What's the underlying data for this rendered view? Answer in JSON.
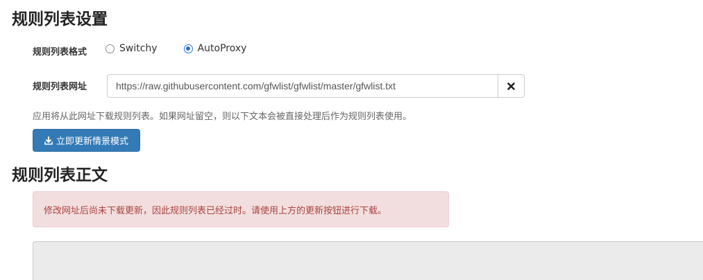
{
  "rule_list_settings": {
    "title": "规则列表设置",
    "format_label": "规则列表格式",
    "format_options": [
      {
        "label": "Switchy",
        "checked": false
      },
      {
        "label": "AutoProxy",
        "checked": true
      }
    ],
    "url_label": "规则列表网址",
    "url_value": "https://raw.githubusercontent.com/gfwlist/gfwlist/master/gfwlist.txt",
    "clear_icon": "close-icon",
    "help_text": "应用将从此网址下载规则列表。如果网址留空，则以下文本会被直接处理后作为规则列表使用。",
    "update_button_label": "立即更新情景模式",
    "update_icon": "download-icon"
  },
  "rule_list_text": {
    "title": "规则列表正文",
    "alert_text": "修改网址后尚未下载更新，因此规则列表已经过时。请使用上方的更新按钮进行下载。",
    "textarea_value": ""
  },
  "colors": {
    "primary": "#337ab7",
    "alert_bg": "#f2dede",
    "alert_text": "#a94442",
    "radio_checked": "#2b6fd6"
  }
}
